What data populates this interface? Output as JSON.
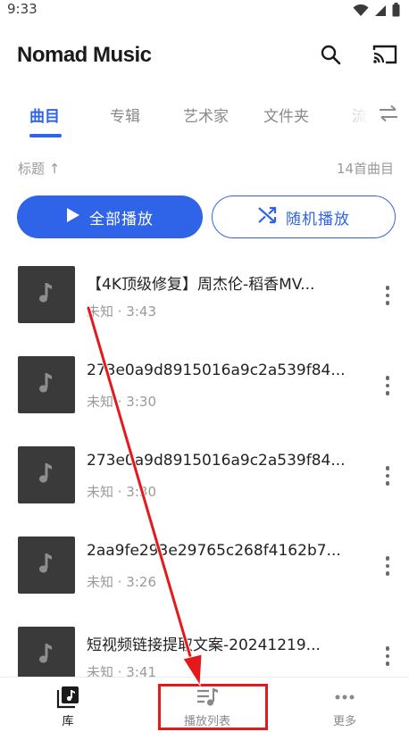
{
  "status": {
    "time": "9:33"
  },
  "header": {
    "title": "Nomad Music"
  },
  "tabs": [
    {
      "label": "曲目",
      "active": true
    },
    {
      "label": "专辑",
      "active": false
    },
    {
      "label": "艺术家",
      "active": false
    },
    {
      "label": "文件夹",
      "active": false
    },
    {
      "label": "流",
      "active": false
    }
  ],
  "sort": {
    "label": "标题 ↑",
    "count": "14首曲目"
  },
  "actions": {
    "play_all": "全部播放",
    "shuffle": "随机播放"
  },
  "songs": [
    {
      "title": "【4K顶级修复】周杰伦-稻香MV...",
      "meta": "未知 · 3:43"
    },
    {
      "title": "273e0a9d8915016a9c2a539f84...",
      "meta": "未知 · 3:30"
    },
    {
      "title": "273e0a9d8915016a9c2a539f84...",
      "meta": "未知 · 3:30"
    },
    {
      "title": "2aa9fe293e29765c268f4162b7...",
      "meta": "未知 · 3:26"
    },
    {
      "title": "短视频链接提取文案-20241219...",
      "meta": "未知 · 3:41"
    }
  ],
  "nav": [
    {
      "label": "库",
      "icon": "library-icon",
      "active": true
    },
    {
      "label": "播放列表",
      "icon": "playlist-icon",
      "active": false
    },
    {
      "label": "更多",
      "icon": "more-horizontal-icon",
      "active": false
    }
  ],
  "colors": {
    "accent": "#2f63e8",
    "annotation": "#e3191c",
    "cover": "#3a3a3a"
  }
}
